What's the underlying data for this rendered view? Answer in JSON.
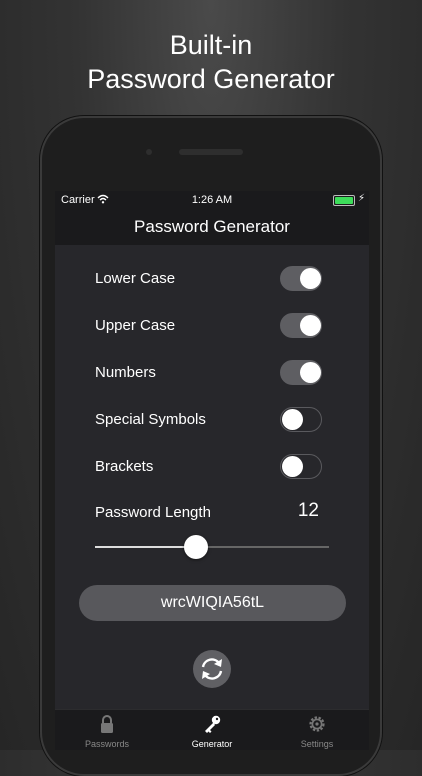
{
  "headline": {
    "line1": "Built-in",
    "line2": "Password Generator"
  },
  "status_bar": {
    "carrier": "Carrier",
    "time": "1:26 AM",
    "battery_color": "#3ddc5a"
  },
  "nav": {
    "title": "Password Generator"
  },
  "options": [
    {
      "label": "Lower Case",
      "on": true
    },
    {
      "label": "Upper Case",
      "on": true
    },
    {
      "label": "Numbers",
      "on": true
    },
    {
      "label": "Special Symbols",
      "on": false
    },
    {
      "label": "Brackets",
      "on": false
    }
  ],
  "length": {
    "label": "Password Length",
    "value": "12",
    "slider_fraction": 0.43
  },
  "password": {
    "value": "wrcWIQIA56tL"
  },
  "refresh": {
    "icon": "refresh-icon"
  },
  "tabs": [
    {
      "label": "Passwords",
      "icon": "lock-icon",
      "active": false
    },
    {
      "label": "Generator",
      "icon": "key-icon",
      "active": true
    },
    {
      "label": "Settings",
      "icon": "gear-icon",
      "active": false
    }
  ],
  "colors": {
    "background": "#27272b",
    "bar": "#1a1a1c",
    "toggle_on": "#5e5e62",
    "field": "#58585c"
  }
}
